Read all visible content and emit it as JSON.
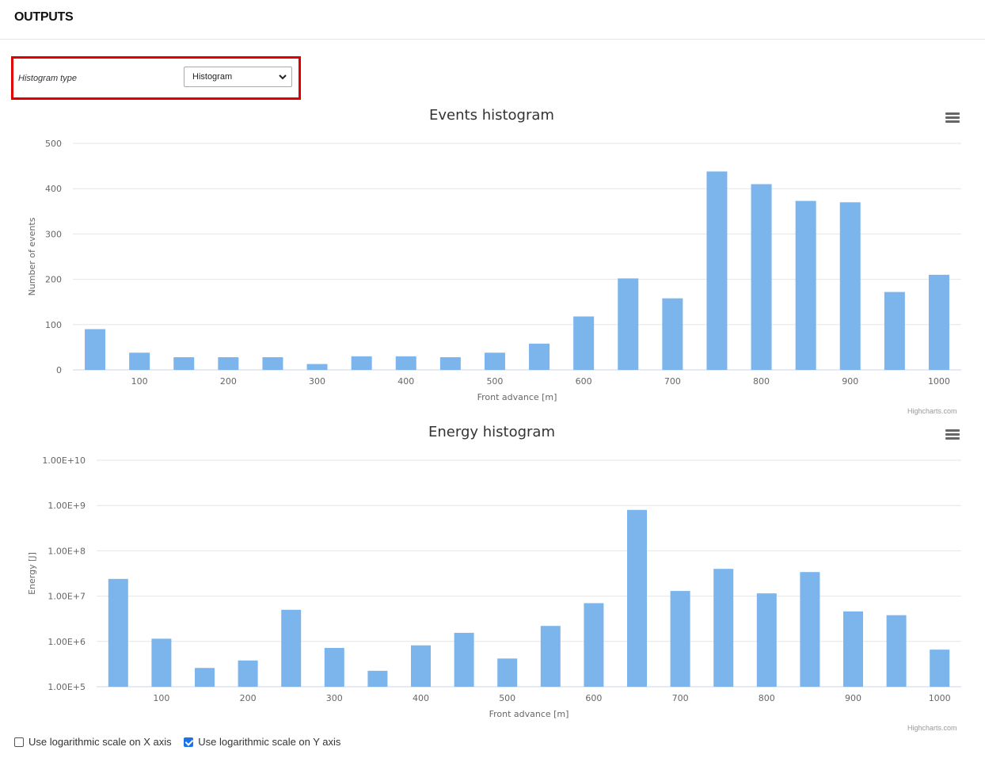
{
  "header": {
    "title": "OUTPUTS"
  },
  "histogram_type": {
    "label": "Histogram type",
    "selected": "Histogram"
  },
  "chart_data": [
    {
      "type": "bar",
      "title": "Events histogram",
      "xlabel": "Front advance [m]",
      "ylabel": "Number of events",
      "x": [
        50,
        100,
        150,
        200,
        250,
        300,
        350,
        400,
        450,
        500,
        550,
        600,
        650,
        700,
        750,
        800,
        850,
        900,
        950,
        1000
      ],
      "values": [
        90,
        38,
        28,
        28,
        28,
        13,
        30,
        30,
        28,
        38,
        58,
        118,
        202,
        158,
        438,
        410,
        373,
        370,
        172,
        210
      ],
      "xticks": [
        "100",
        "200",
        "300",
        "400",
        "500",
        "600",
        "700",
        "800",
        "900",
        "1000"
      ],
      "yticks": [
        "0",
        "100",
        "200",
        "300",
        "400",
        "500"
      ],
      "ylim": [
        0,
        500
      ],
      "xlim": [
        25,
        1025
      ],
      "color": "#7cb5ec",
      "credits": "Highcharts.com"
    },
    {
      "type": "bar",
      "title": "Energy histogram",
      "xlabel": "Front advance [m]",
      "ylabel": "Energy [J]",
      "yscale": "log",
      "x": [
        50,
        100,
        150,
        200,
        250,
        300,
        350,
        400,
        450,
        500,
        550,
        600,
        650,
        700,
        750,
        800,
        850,
        900,
        950,
        1000
      ],
      "values": [
        24000000,
        1150000,
        260000,
        380000,
        5000000,
        720000,
        225000,
        820000,
        1550000,
        420000,
        2200000,
        7000000,
        800000000,
        13000000,
        40000000,
        11500000,
        34000000,
        4600000,
        3800000,
        660000
      ],
      "xticks": [
        "100",
        "200",
        "300",
        "400",
        "500",
        "600",
        "700",
        "800",
        "900",
        "1000"
      ],
      "yticks": [
        "1.00E+5",
        "1.00E+6",
        "1.00E+7",
        "1.00E+8",
        "1.00E+9",
        "1.00E+10"
      ],
      "ylim": [
        100000,
        10000000000
      ],
      "xlim": [
        25,
        1025
      ],
      "color": "#7cb5ec",
      "credits": "Highcharts.com"
    }
  ],
  "options": {
    "log_x_label": "Use logarithmic scale on X axis",
    "log_x_checked": false,
    "log_y_label": "Use logarithmic scale on Y axis",
    "log_y_checked": true
  }
}
